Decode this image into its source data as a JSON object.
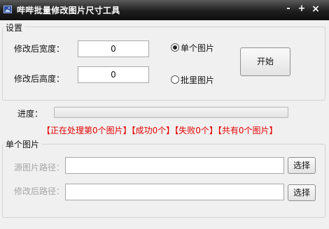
{
  "window": {
    "title": "哔哔批量修改图片尺寸工具",
    "min_label": "-",
    "max_label": "+",
    "close_label": "×"
  },
  "settings": {
    "group_title": "设置",
    "width_label": "修改后宽度：",
    "width_value": "0",
    "height_label": "修改后高度：",
    "height_value": "0",
    "mode_single_label": "单个图片",
    "mode_batch_label": "批里图片",
    "selected_mode": "single",
    "start_button": "开始"
  },
  "progress": {
    "label": "进度：",
    "value": 0
  },
  "status_text": "【正在处理第0个图片】【成功0个】【失败0个】【共有0个图片】",
  "single": {
    "group_title": "单个图片",
    "source_label": "源图片路径：",
    "source_value": "",
    "target_label": "修改后路径：",
    "target_value": "",
    "browse_label": "选择"
  },
  "colors": {
    "status_text": "#e60000",
    "note_text": "#1a3fb8",
    "title_bar": "#1e1e1e"
  }
}
